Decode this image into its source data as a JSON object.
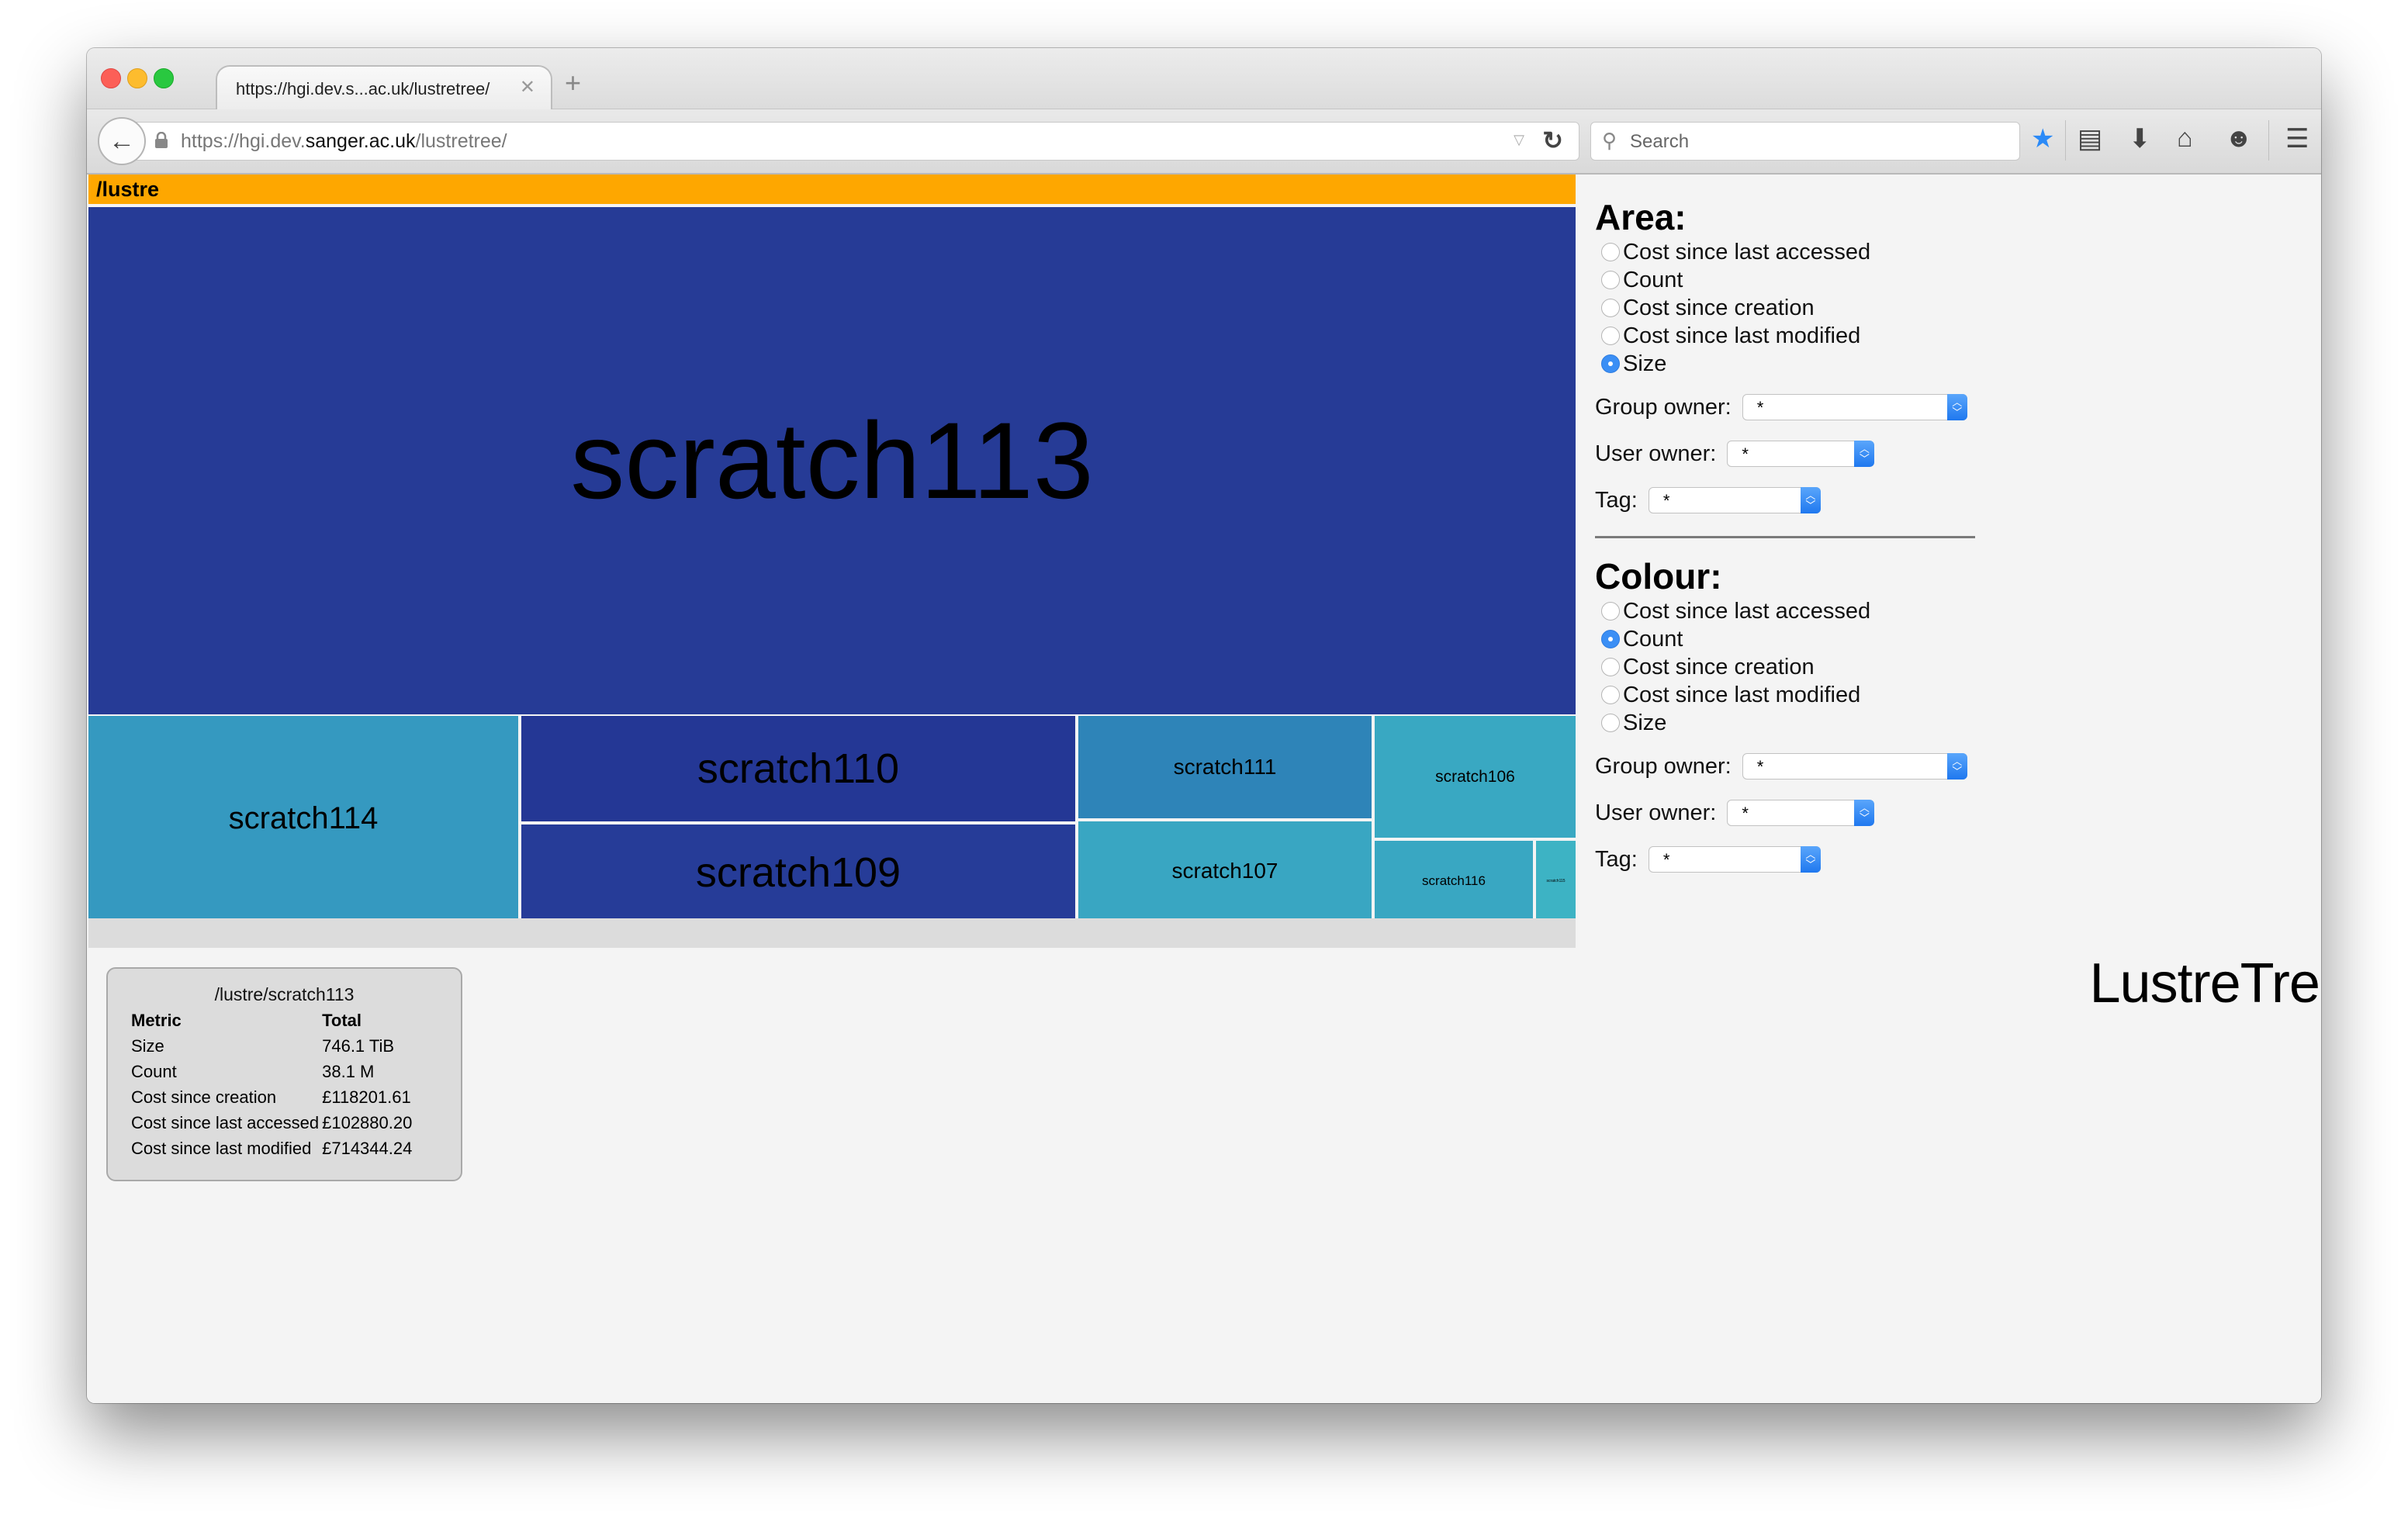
{
  "browser": {
    "tab_title": "https://hgi.dev.s...ac.uk/lustretree/",
    "tab_close_icon": "close-icon",
    "new_tab_icon": "plus-icon",
    "url_prefix": "https://hgi.dev.",
    "url_domain": "sanger.ac.uk",
    "url_path": "/lustretree/",
    "search_placeholder": "Search",
    "toolbar_icons": [
      "bookmark-star-icon",
      "reading-list-icon",
      "download-icon",
      "home-icon",
      "chat-icon",
      "menu-icon"
    ]
  },
  "treemap": {
    "root_label": "/lustre",
    "cells": [
      {
        "name": "scratch113",
        "color": "#263b96"
      },
      {
        "name": "scratch114",
        "color": "#3599c0"
      },
      {
        "name": "scratch110",
        "color": "#243795"
      },
      {
        "name": "scratch109",
        "color": "#263c98"
      },
      {
        "name": "scratch111",
        "color": "#2e84b8"
      },
      {
        "name": "scratch107",
        "color": "#39a6c2"
      },
      {
        "name": "scratch106",
        "color": "#39a8c2"
      },
      {
        "name": "scratch116",
        "color": "#39a7c2"
      },
      {
        "name": "scratch115",
        "color": "#3db3c4"
      }
    ]
  },
  "app_title": "LustreTree",
  "tooltip": {
    "path": "/lustre/scratch113",
    "header": {
      "metric": "Metric",
      "total": "Total"
    },
    "rows": [
      {
        "metric": "Size",
        "total": "746.1 TiB"
      },
      {
        "metric": "Count",
        "total": "38.1 M"
      },
      {
        "metric": "Cost since creation",
        "total": "£118201.61"
      },
      {
        "metric": "Cost since last accessed",
        "total": "£102880.20"
      },
      {
        "metric": "Cost since last modified",
        "total": "£714344.24"
      }
    ]
  },
  "panel": {
    "area": {
      "title": "Area:",
      "options": [
        "Cost since last accessed",
        "Count",
        "Cost since creation",
        "Cost since last modified",
        "Size"
      ],
      "selected": "Size",
      "group_owner_label": "Group owner:",
      "group_owner_value": "*",
      "user_owner_label": "User owner:",
      "user_owner_value": "*",
      "tag_label": "Tag:",
      "tag_value": "*"
    },
    "colour": {
      "title": "Colour:",
      "options": [
        "Cost since last accessed",
        "Count",
        "Cost since creation",
        "Cost since last modified",
        "Size"
      ],
      "selected": "Count",
      "group_owner_label": "Group owner:",
      "group_owner_value": "*",
      "user_owner_label": "User owner:",
      "user_owner_value": "*",
      "tag_label": "Tag:",
      "tag_value": "*"
    }
  }
}
